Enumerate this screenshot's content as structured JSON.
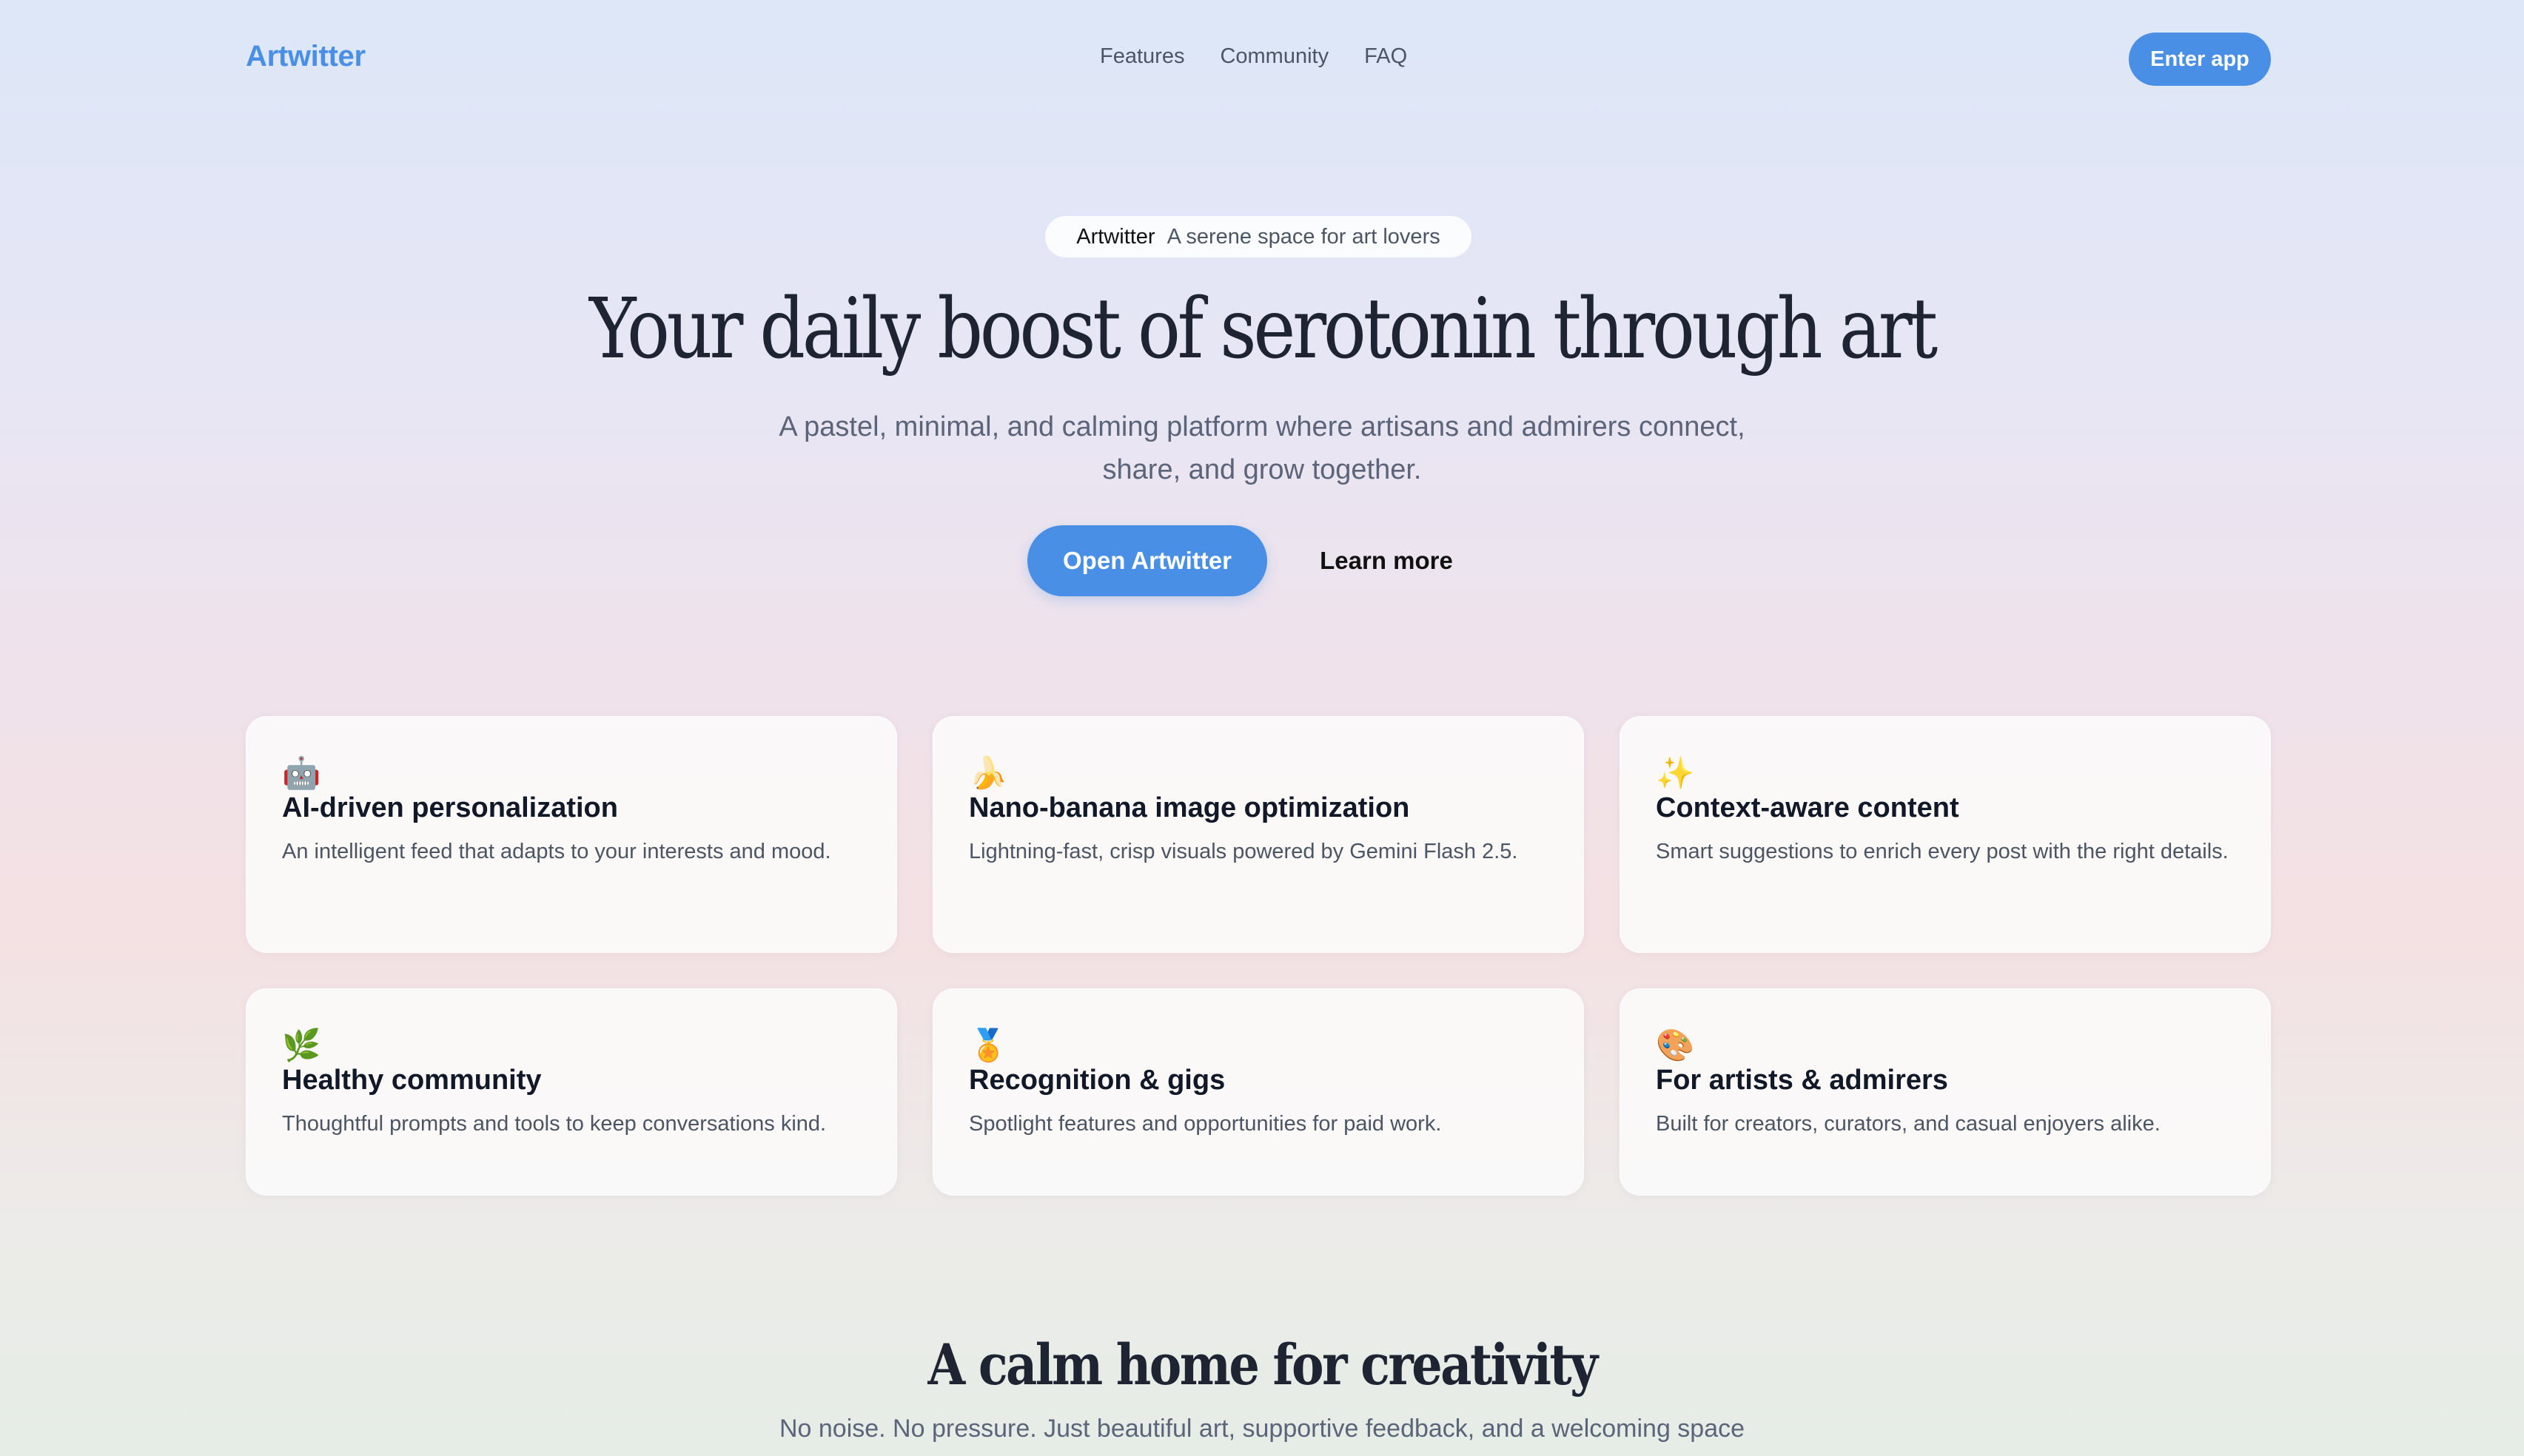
{
  "header": {
    "brand": "Artwitter",
    "nav": [
      "Features",
      "Community",
      "FAQ"
    ],
    "enter_label": "Enter app"
  },
  "hero": {
    "pill_brand": "Artwitter",
    "pill_tagline": "A serene space for art lovers",
    "title": "Your daily boost of serotonin through art",
    "subtitle": "A pastel, minimal, and calming platform where artisans and admirers connect, share, and grow together.",
    "primary_cta": "Open Artwitter",
    "secondary_cta": "Learn more"
  },
  "features": [
    {
      "icon": "🤖",
      "icon_name": "robot-icon",
      "title": "AI-driven personalization",
      "desc": "An intelligent feed that adapts to your interests and mood."
    },
    {
      "icon": "🍌",
      "icon_name": "banana-icon",
      "title": "Nano-banana image optimization",
      "desc": "Lightning-fast, crisp visuals powered by Gemini Flash 2.5."
    },
    {
      "icon": "✨",
      "icon_name": "sparkles-icon",
      "title": "Context-aware content",
      "desc": "Smart suggestions to enrich every post with the right details."
    },
    {
      "icon": "🌿",
      "icon_name": "herb-icon",
      "title": "Healthy community",
      "desc": "Thoughtful prompts and tools to keep conversations kind."
    },
    {
      "icon": "🏅",
      "icon_name": "medal-icon",
      "title": "Recognition & gigs",
      "desc": "Spotlight features and opportunities for paid work."
    },
    {
      "icon": "🎨",
      "icon_name": "palette-icon",
      "title": "For artists & admirers",
      "desc": "Built for creators, curators, and casual enjoyers alike."
    }
  ],
  "about": {
    "title": "A calm home for creativity",
    "subtitle": "No noise. No pressure. Just beautiful art, supportive feedback, and a welcoming space"
  },
  "colors": {
    "accent": "#4a8fe6",
    "text": "#1f2433",
    "muted": "#5b6478"
  }
}
